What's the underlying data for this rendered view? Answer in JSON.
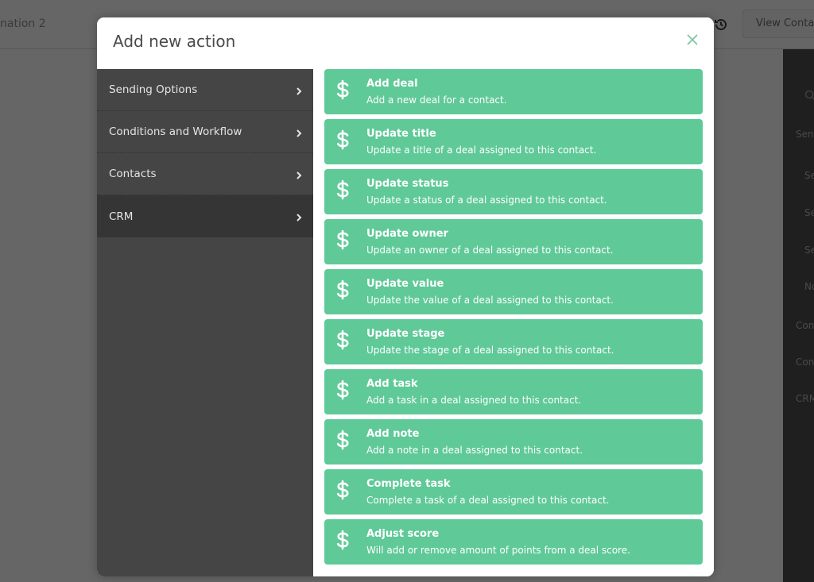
{
  "background": {
    "page_title_fragment": "nation 2",
    "view_button_label": "View Contac",
    "right_panel_items": [
      "Senc",
      "Se",
      "Se",
      "Se",
      "No",
      "Con",
      "Con",
      "CRM"
    ]
  },
  "modal": {
    "title": "Add new action",
    "close_icon": "close-icon",
    "accent_color": "#5fc998",
    "sidebar": {
      "items": [
        {
          "label": "Sending Options",
          "active": false
        },
        {
          "label": "Conditions and Workflow",
          "active": false
        },
        {
          "label": "Contacts",
          "active": false
        },
        {
          "label": "CRM",
          "active": true
        }
      ]
    },
    "actions": [
      {
        "icon": "dollar-icon",
        "title": "Add deal",
        "description": "Add a new deal for a contact."
      },
      {
        "icon": "dollar-icon",
        "title": "Update title",
        "description": "Update a title of a deal assigned to this contact."
      },
      {
        "icon": "dollar-icon",
        "title": "Update status",
        "description": "Update a status of a deal assigned to this contact."
      },
      {
        "icon": "dollar-icon",
        "title": "Update owner",
        "description": "Update an owner of a deal assigned to this contact."
      },
      {
        "icon": "dollar-icon",
        "title": "Update value",
        "description": "Update the value of a deal assigned to this contact."
      },
      {
        "icon": "dollar-icon",
        "title": "Update stage",
        "description": "Update the stage of a deal assigned to this contact."
      },
      {
        "icon": "dollar-icon",
        "title": "Add task",
        "description": "Add a task in a deal assigned to this contact."
      },
      {
        "icon": "dollar-icon",
        "title": "Add note",
        "description": "Add a note in a deal assigned to this contact."
      },
      {
        "icon": "dollar-icon",
        "title": "Complete task",
        "description": "Complete a task of a deal assigned to this contact."
      },
      {
        "icon": "dollar-icon",
        "title": "Adjust score",
        "description": "Will add or remove amount of points from a deal score."
      }
    ]
  }
}
